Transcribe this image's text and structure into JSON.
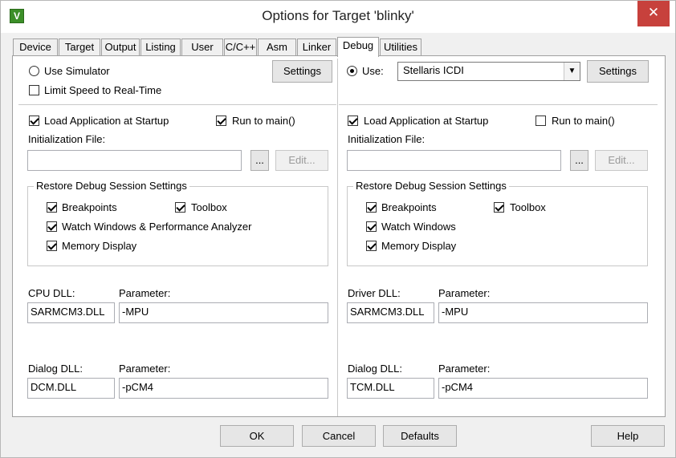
{
  "window": {
    "title": "Options for Target 'blinky'",
    "app_icon_glyph": "V",
    "close_glyph": "✕"
  },
  "tabs": [
    "Device",
    "Target",
    "Output",
    "Listing",
    "User",
    "C/C++",
    "Asm",
    "Linker",
    "Debug",
    "Utilities"
  ],
  "active_tab": "Debug",
  "left": {
    "use_simulator": {
      "label": "Use Simulator",
      "selected": false
    },
    "settings_label": "Settings",
    "limit_speed": {
      "label": "Limit Speed to Real-Time",
      "checked": false
    },
    "load_app": {
      "label": "Load Application at Startup",
      "checked": true
    },
    "run_to_main": {
      "label": "Run to main()",
      "checked": true
    },
    "init_file_label": "Initialization File:",
    "init_file_value": "",
    "browse_label": "...",
    "edit_label": "Edit...",
    "restore_title": "Restore Debug Session Settings",
    "breakpoints": {
      "label": "Breakpoints",
      "checked": true
    },
    "toolbox": {
      "label": "Toolbox",
      "checked": true
    },
    "watch": {
      "label": "Watch Windows & Performance Analyzer",
      "checked": true
    },
    "memory": {
      "label": "Memory Display",
      "checked": true
    },
    "cpu_dll_label": "CPU DLL:",
    "cpu_dll_value": "SARMCM3.DLL",
    "cpu_param_label": "Parameter:",
    "cpu_param_value": "-MPU",
    "dialog_dll_label": "Dialog DLL:",
    "dialog_dll_value": "DCM.DLL",
    "dialog_param_label": "Parameter:",
    "dialog_param_value": "-pCM4"
  },
  "right": {
    "use": {
      "label": "Use:",
      "selected": true
    },
    "driver_value": "Stellaris ICDI",
    "settings_label": "Settings",
    "load_app": {
      "label": "Load Application at Startup",
      "checked": true
    },
    "run_to_main": {
      "label": "Run to main()",
      "checked": false
    },
    "init_file_label": "Initialization File:",
    "init_file_value": "",
    "browse_label": "...",
    "edit_label": "Edit...",
    "restore_title": "Restore Debug Session Settings",
    "breakpoints": {
      "label": "Breakpoints",
      "checked": true
    },
    "toolbox": {
      "label": "Toolbox",
      "checked": true
    },
    "watch": {
      "label": "Watch Windows",
      "checked": true
    },
    "memory": {
      "label": "Memory Display",
      "checked": true
    },
    "driver_dll_label": "Driver DLL:",
    "driver_dll_value": "SARMCM3.DLL",
    "driver_param_label": "Parameter:",
    "driver_param_value": "-MPU",
    "dialog_dll_label": "Dialog DLL:",
    "dialog_dll_value": "TCM.DLL",
    "dialog_param_label": "Parameter:",
    "dialog_param_value": "-pCM4"
  },
  "footer": {
    "ok": "OK",
    "cancel": "Cancel",
    "defaults": "Defaults",
    "help": "Help"
  }
}
